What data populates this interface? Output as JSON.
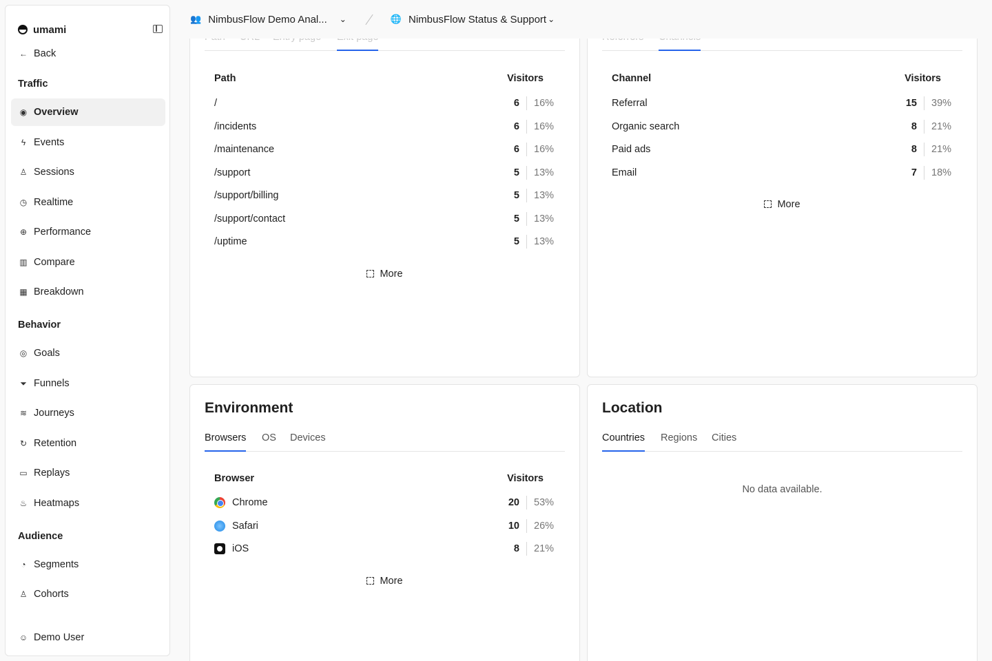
{
  "app": {
    "name": "umami"
  },
  "sidebar": {
    "back": "Back",
    "sections": {
      "traffic": "Traffic",
      "behavior": "Behavior",
      "audience": "Audience"
    },
    "items": {
      "overview": "Overview",
      "events": "Events",
      "sessions": "Sessions",
      "realtime": "Realtime",
      "performance": "Performance",
      "compare": "Compare",
      "breakdown": "Breakdown",
      "goals": "Goals",
      "funnels": "Funnels",
      "journeys": "Journeys",
      "retention": "Retention",
      "replays": "Replays",
      "heatmaps": "Heatmaps",
      "segments": "Segments",
      "cohorts": "Cohorts"
    },
    "user": "Demo User"
  },
  "topbar": {
    "team": "NimbusFlow Demo Anal...",
    "website": "NimbusFlow Status & Support"
  },
  "pages": {
    "tabs": [
      "Path",
      "URL",
      "Entry page",
      "Exit page"
    ],
    "col_label": "Path",
    "col_value": "Visitors",
    "rows": [
      {
        "label": "/",
        "value": "6",
        "pct": "16%"
      },
      {
        "label": "/incidents",
        "value": "6",
        "pct": "16%"
      },
      {
        "label": "/maintenance",
        "value": "6",
        "pct": "16%"
      },
      {
        "label": "/support",
        "value": "5",
        "pct": "13%"
      },
      {
        "label": "/support/billing",
        "value": "5",
        "pct": "13%"
      },
      {
        "label": "/support/contact",
        "value": "5",
        "pct": "13%"
      },
      {
        "label": "/uptime",
        "value": "5",
        "pct": "13%"
      }
    ],
    "more": "More"
  },
  "sources": {
    "tabs": [
      "Referrers",
      "Channels"
    ],
    "col_label": "Channel",
    "col_value": "Visitors",
    "rows": [
      {
        "label": "Referral",
        "value": "15",
        "pct": "39%"
      },
      {
        "label": "Organic search",
        "value": "8",
        "pct": "21%"
      },
      {
        "label": "Paid ads",
        "value": "8",
        "pct": "21%"
      },
      {
        "label": "Email",
        "value": "7",
        "pct": "18%"
      }
    ],
    "more": "More"
  },
  "environment": {
    "title": "Environment",
    "tabs": [
      "Browsers",
      "OS",
      "Devices"
    ],
    "col_label": "Browser",
    "col_value": "Visitors",
    "rows": [
      {
        "label": "Chrome",
        "icon": "chrome-icon",
        "value": "20",
        "pct": "53%"
      },
      {
        "label": "Safari",
        "icon": "safari-icon",
        "value": "10",
        "pct": "26%"
      },
      {
        "label": "iOS",
        "icon": "ios-icon",
        "value": "8",
        "pct": "21%"
      }
    ],
    "more": "More"
  },
  "location": {
    "title": "Location",
    "tabs": [
      "Countries",
      "Regions",
      "Cities"
    ],
    "empty": "No data available."
  },
  "colors": {
    "accent": "#2563eb"
  }
}
